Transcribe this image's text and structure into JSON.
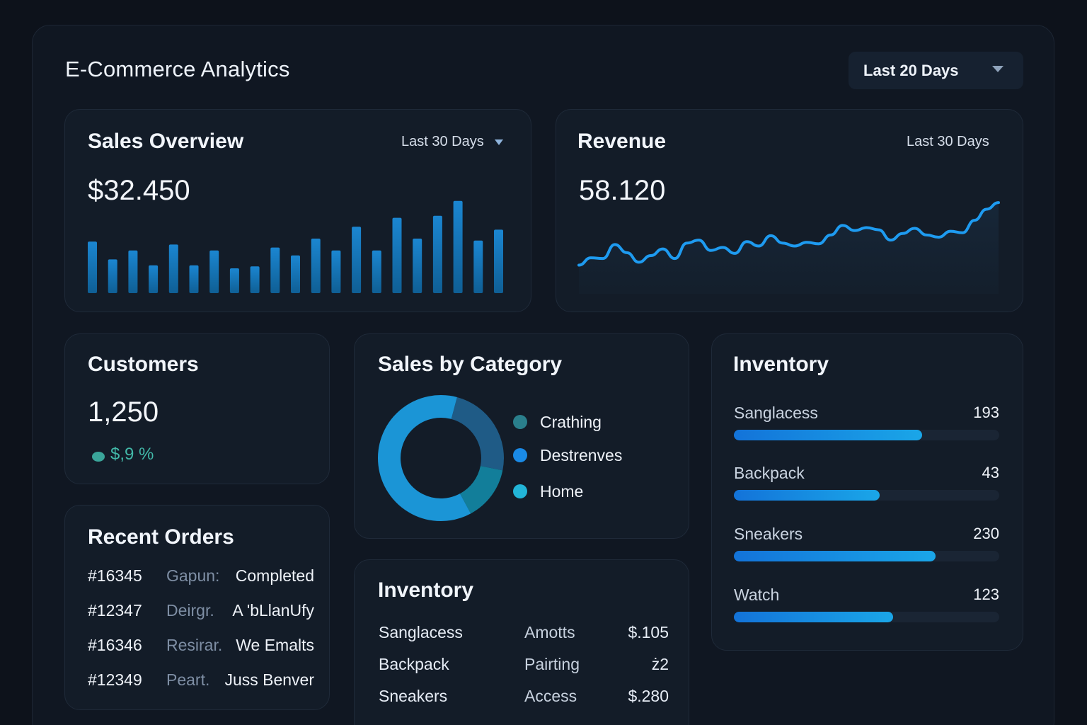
{
  "header": {
    "title": "E-Commerce Analytics",
    "range_label": "Last 20 Days"
  },
  "sales_overview": {
    "title": "Sales Overview",
    "range_label": "Last 30 Days",
    "value": "$32.450",
    "chart_data": {
      "type": "bar",
      "values": [
        52,
        34,
        43,
        28,
        49,
        28,
        43,
        25,
        27,
        46,
        38,
        55,
        43,
        67,
        43,
        76,
        55,
        78,
        93,
        53,
        64
      ]
    }
  },
  "revenue": {
    "title": "Revenue",
    "range_label": "Last 30 Days",
    "value": "58.120",
    "chart_data": {
      "type": "area",
      "values": [
        12,
        22,
        21,
        40,
        29,
        16,
        25,
        34,
        21,
        42,
        46,
        32,
        36,
        28,
        44,
        38,
        52,
        42,
        38,
        43,
        41,
        53,
        66,
        59,
        63,
        60,
        46,
        55,
        62,
        53,
        50,
        58,
        56,
        73,
        88,
        97
      ]
    }
  },
  "customers": {
    "title": "Customers",
    "value": "1,250",
    "delta": "$,9 %"
  },
  "recent_orders": {
    "title": "Recent Orders",
    "rows": [
      {
        "id": "#16345",
        "name": "Gapun:",
        "status": "Completed"
      },
      {
        "id": "#12347",
        "name": "Deirgr.",
        "status": "A 'bLlanUfy"
      },
      {
        "id": "#16346",
        "name": "Resirar.",
        "status": "We Emalts"
      },
      {
        "id": "#12349",
        "name": "Peart.",
        "status": "Juss Benver"
      }
    ]
  },
  "sales_by_category": {
    "title": "Sales by Category",
    "chart_data": {
      "type": "pie",
      "categories": [
        "Crathing",
        "Destrenves",
        "Home"
      ],
      "values": [
        0.24,
        0.14,
        0.62
      ]
    },
    "legend": [
      {
        "label": "Crathing",
        "color": "#2a7f8c"
      },
      {
        "label": "Destrenves",
        "color": "#1a8ae6"
      },
      {
        "label": "Home",
        "color": "#22b5d8"
      }
    ]
  },
  "inventory_table": {
    "title": "Inventory",
    "rows": [
      {
        "item": "Sanglacess",
        "type": "Amotts",
        "value": "$.105"
      },
      {
        "item": "Backpack",
        "type": "Pairting",
        "value": "ż2"
      },
      {
        "item": "Sneakers",
        "type": "Access",
        "value": "$.280"
      }
    ]
  },
  "inventory_bars": {
    "title": "Inventory",
    "items": [
      {
        "label": "Sanglacess",
        "value": "193",
        "fill": 0.71
      },
      {
        "label": "Backpack",
        "value": "43",
        "fill": 0.55
      },
      {
        "label": "Sneakers",
        "value": "230",
        "fill": 0.76
      },
      {
        "label": "Watch",
        "value": "123",
        "fill": 0.6
      }
    ]
  }
}
